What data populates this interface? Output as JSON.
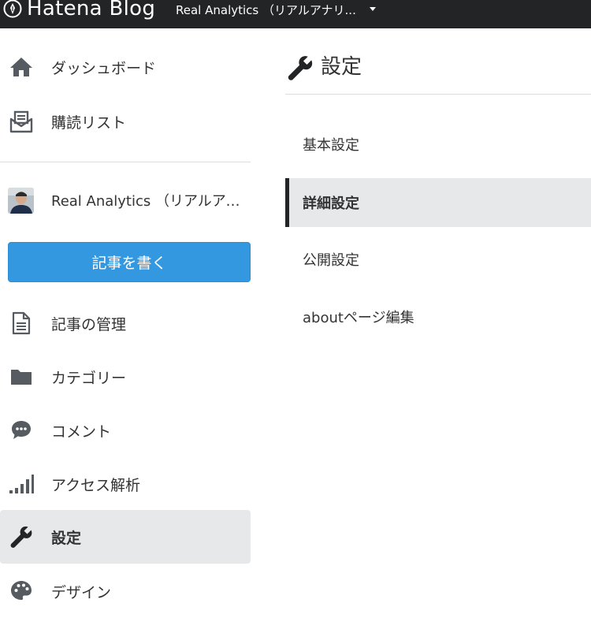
{
  "topbar": {
    "brand": "Hatena Blog",
    "blog_name": "Real Analytics （リアルアナリ..."
  },
  "sidebar": {
    "items_top": [
      {
        "label": "ダッシュボード",
        "icon": "home-icon"
      },
      {
        "label": "購読リスト",
        "icon": "subscribe-icon"
      }
    ],
    "blog_name": "Real Analytics （リアルアナリティクス）",
    "write_button": "記事を書く",
    "items": [
      {
        "label": "記事の管理",
        "icon": "document-icon"
      },
      {
        "label": "カテゴリー",
        "icon": "folder-icon"
      },
      {
        "label": "コメント",
        "icon": "comment-icon"
      },
      {
        "label": "アクセス解析",
        "icon": "bar-chart-icon"
      },
      {
        "label": "設定",
        "icon": "wrench-icon",
        "active": true
      },
      {
        "label": "デザイン",
        "icon": "palette-icon"
      }
    ]
  },
  "main": {
    "title": "設定",
    "subnav": [
      {
        "label": "基本設定"
      },
      {
        "label": "詳細設定",
        "active": true
      },
      {
        "label": "公開設定"
      },
      {
        "label": "aboutページ編集"
      }
    ]
  },
  "colors": {
    "topbar_bg": "#222426",
    "accent_button": "#3498e1",
    "active_bg": "#e6e8ea",
    "icon_color": "#555b61"
  }
}
